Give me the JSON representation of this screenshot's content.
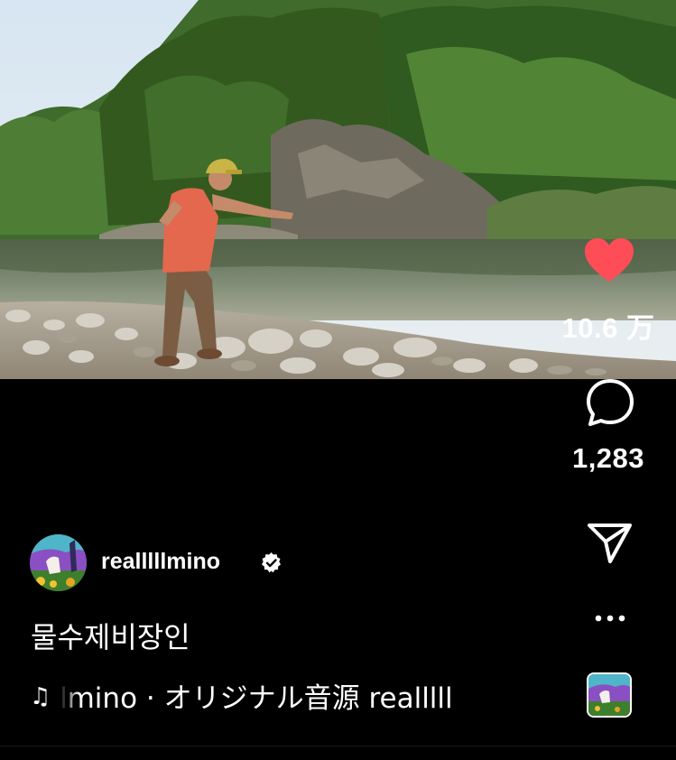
{
  "actions": {
    "likes_count": "10.6 万",
    "comments_count": "1,283"
  },
  "author": {
    "username": "realllllmino"
  },
  "caption": "물수제비장인",
  "audio": {
    "label": "lmino · オリジナル音源  realllll"
  },
  "colors": {
    "like_heart": "#ff4d57",
    "background": "#000000",
    "text": "#ffffff"
  },
  "icons": [
    "heart-icon",
    "comment-icon",
    "share-icon",
    "more-icon",
    "verified-icon",
    "music-note-icon"
  ]
}
